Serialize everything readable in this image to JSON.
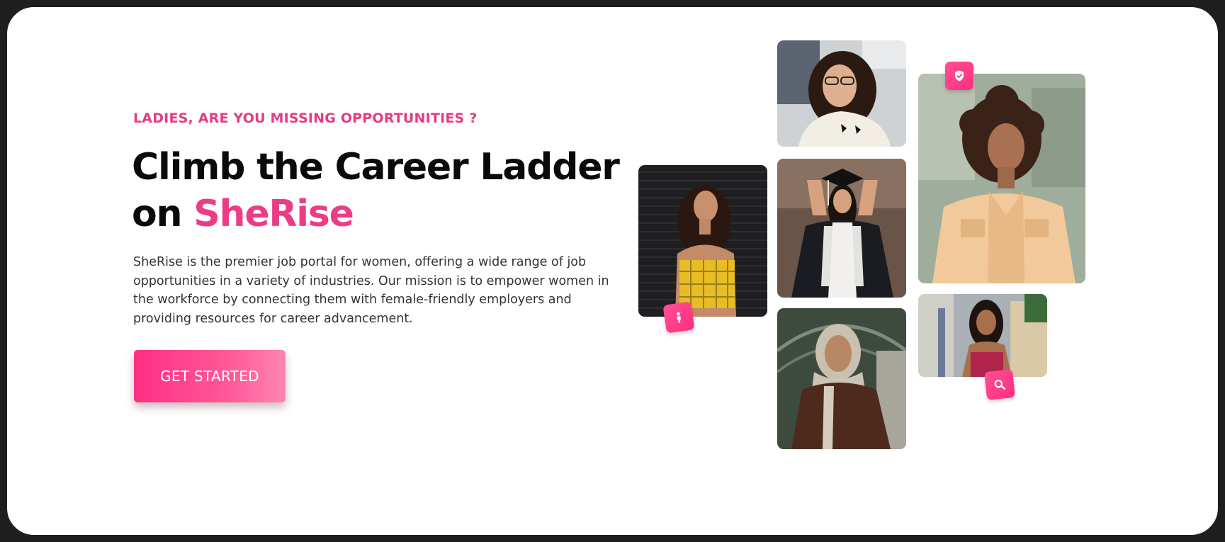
{
  "hero": {
    "eyebrow": "LADIES, ARE YOU MISSING OPPORTUNITIES ?",
    "headline_line1": "Climb the Career Ladder",
    "headline_prefix": "on ",
    "headline_brand": "SheRise",
    "description": "SheRise is the premier job portal for women, offering a wide range of job opportunities in a variety of industries. Our mission is to empower women in the workforce by connecting them with female-friendly employers and providing resources for career advancement.",
    "cta_label": "GET STARTED"
  },
  "gallery": {
    "badges": [
      "person-icon",
      "shield-check-icon",
      "search-icon"
    ]
  },
  "colors": {
    "accent": "#ec3b87",
    "cta_gradient_start": "#ff2f84",
    "cta_gradient_end": "#ff86b3",
    "heading": "#0a0a0a",
    "body_text": "#333333"
  }
}
